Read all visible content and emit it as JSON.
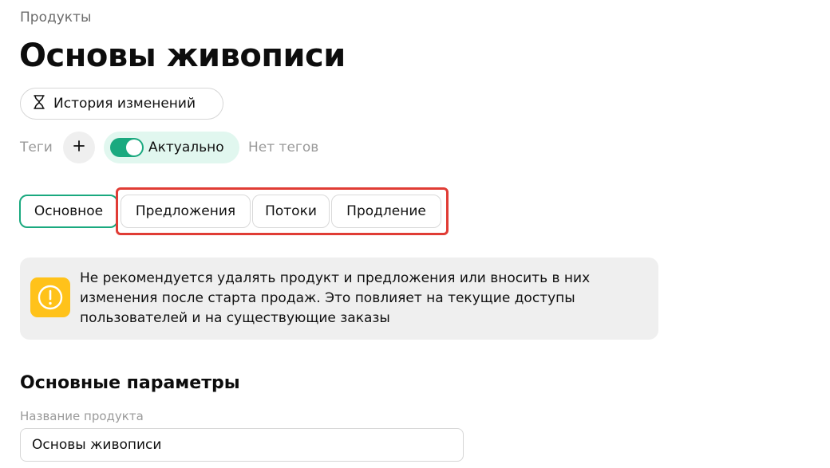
{
  "breadcrumb": "Продукты",
  "title": "Основы живописи",
  "history_button": {
    "label": "История изменений",
    "icon": "hourglass-icon"
  },
  "tags": {
    "label": "Теги",
    "add_icon": "plus-icon",
    "status": {
      "label": "Актуально",
      "on": true
    },
    "empty_text": "Нет тегов"
  },
  "tabs": [
    {
      "label": "Основное",
      "active": true
    },
    {
      "label": "Предложения",
      "active": false
    },
    {
      "label": "Потоки",
      "active": false
    },
    {
      "label": "Продление",
      "active": false
    }
  ],
  "warning": {
    "icon": "warning-icon",
    "text": "Не рекомендуется удалять продукт и предложения или вносить в них изменения после старта продаж. Это повлияет на текущие доступы пользователей и на существующие заказы"
  },
  "section": {
    "title": "Основные параметры",
    "product_name_label": "Название продукта",
    "product_name_value": "Основы живописи"
  },
  "colors": {
    "accent": "#1aa97f",
    "status_bg": "#e1f7ef",
    "warning_icon": "#ffc21a",
    "highlight": "#e03c35"
  }
}
